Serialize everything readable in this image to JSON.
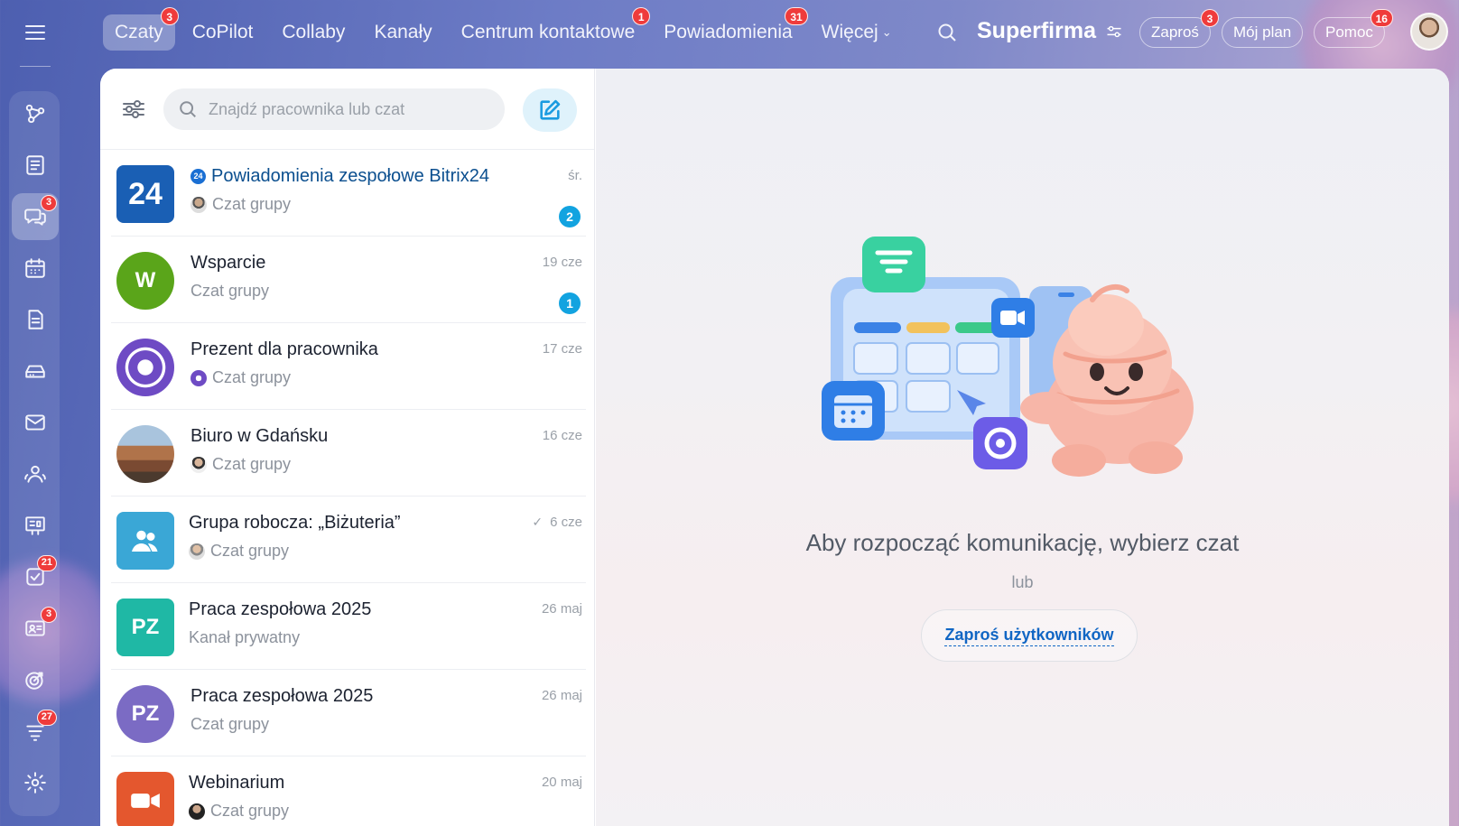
{
  "topnav": {
    "tabs": [
      {
        "label": "Czaty",
        "badge": "3",
        "active": true
      },
      {
        "label": "CoPilot",
        "badge": ""
      },
      {
        "label": "Collaby",
        "badge": ""
      },
      {
        "label": "Kanały",
        "badge": ""
      },
      {
        "label": "Centrum kontaktowe",
        "badge": "1"
      },
      {
        "label": "Powiadomienia",
        "badge": "31"
      },
      {
        "label": "Więcej",
        "badge": ""
      }
    ],
    "brand": "Superfirma",
    "invite": {
      "label": "Zaproś",
      "badge": "3"
    },
    "plan": {
      "label": "Mój plan"
    },
    "help": {
      "label": "Pomoc",
      "badge": "16"
    }
  },
  "rail": {
    "items": [
      {
        "icon": "flow-icon"
      },
      {
        "icon": "feed-icon"
      },
      {
        "icon": "chat-icon",
        "badge": "3",
        "active": true
      },
      {
        "icon": "calendar-icon"
      },
      {
        "icon": "document-icon"
      },
      {
        "icon": "drive-icon"
      },
      {
        "icon": "mail-icon"
      },
      {
        "icon": "people-icon"
      },
      {
        "icon": "board-icon"
      },
      {
        "icon": "tasks-icon",
        "badge": "21"
      },
      {
        "icon": "crm-icon",
        "badge": "3"
      },
      {
        "icon": "target-icon"
      },
      {
        "icon": "stream-icon",
        "badge": "27"
      },
      {
        "icon": "settings-icon"
      }
    ]
  },
  "search": {
    "placeholder": "Znajdź pracownika lub czat"
  },
  "chats": [
    {
      "title": "Powiadomienia zespołowe Bitrix24",
      "subtitle": "Czat grupy",
      "date": "śr.",
      "unread": "2",
      "avatar_text": "24",
      "avatar_color": "#1a5fb4"
    },
    {
      "title": "Wsparcie",
      "subtitle": "Czat grupy",
      "date": "19 cze",
      "unread": "1",
      "avatar_text": "W",
      "avatar_color": "#5aa51a"
    },
    {
      "title": "Prezent dla pracownika",
      "subtitle": "Czat grupy",
      "date": "17 cze",
      "unread": "",
      "avatar_text": "",
      "avatar_color": "#6e4bc4"
    },
    {
      "title": "Biuro w Gdańsku",
      "subtitle": "Czat grupy",
      "date": "16 cze",
      "unread": "",
      "avatar_text": "",
      "avatar_color": "#8a5a3a"
    },
    {
      "title": "Grupa robocza: „Biżuteria”",
      "subtitle": "Czat grupy",
      "date": "6 cze",
      "unread": "",
      "avatar_text": "",
      "avatar_color": "#3aa7d6"
    },
    {
      "title": "Praca zespołowa 2025",
      "subtitle": "Kanał prywatny",
      "date": "26 maj",
      "unread": "",
      "avatar_text": "PZ",
      "avatar_color": "#1fb8a5"
    },
    {
      "title": "Praca zespołowa 2025",
      "subtitle": "Czat grupy",
      "date": "26 maj",
      "unread": "",
      "avatar_text": "PZ",
      "avatar_color": "#7b6bc4"
    },
    {
      "title": "Webinarium",
      "subtitle": "Czat grupy",
      "date": "20 maj",
      "unread": "",
      "avatar_text": "",
      "avatar_color": "#e4572e"
    }
  ],
  "empty_state": {
    "title": "Aby rozpocząć komunikację, wybierz czat",
    "or": "lub",
    "invite_button": "Zaproś użytkowników"
  }
}
